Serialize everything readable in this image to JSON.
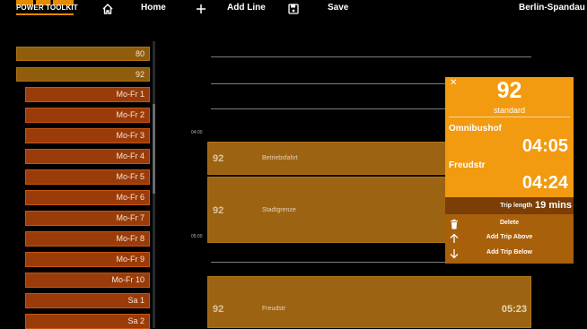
{
  "header": {
    "logo_text": "POWER TOOLKIT",
    "home_label": "Home",
    "add_line_label": "Add Line",
    "save_label": "Save",
    "location": "Berlin-Spandau"
  },
  "sidebar": {
    "routes": [
      "80",
      "92"
    ],
    "trips": [
      "Mo-Fr 1",
      "Mo-Fr 2",
      "Mo-Fr 3",
      "Mo-Fr 4",
      "Mo-Fr 5",
      "Mo-Fr 6",
      "Mo-Fr 7",
      "Mo-Fr 8",
      "Mo-Fr 9",
      "Mo-Fr 10",
      "Sa 1",
      "Sa 2"
    ]
  },
  "timeline": {
    "time_labels": [
      "04:00",
      "05:00"
    ],
    "blocks": [
      {
        "line": "92",
        "stop": "Betriebsfahrt",
        "time": ""
      },
      {
        "line": "92",
        "stop": "Stadtgrenze",
        "time": ""
      },
      {
        "line": "92",
        "stop": "Freudstr",
        "time": "05:23"
      }
    ]
  },
  "popup": {
    "close_symbol": "✕",
    "line": "92",
    "type": "standard",
    "start_stop": "Omnibushof",
    "start_time": "04:05",
    "end_stop": "Freudstr",
    "end_time": "04:24",
    "trip_length_label": "Trip length",
    "trip_length_value": "19 mins",
    "actions": {
      "delete": "Delete",
      "add_above": "Add Trip Above",
      "add_below": "Add Trip Below"
    }
  },
  "colors": {
    "accent": "#f29a10",
    "route_row": "#8f5d0c",
    "trip_row": "#9a3c0a",
    "trip_block": "#9c6412"
  },
  "icons": {
    "home": "home-icon",
    "add": "plus-icon",
    "save": "floppy-disk-icon",
    "close": "close-icon",
    "delete": "trash-icon",
    "add_above": "arrow-up-icon",
    "add_below": "arrow-down-icon"
  }
}
